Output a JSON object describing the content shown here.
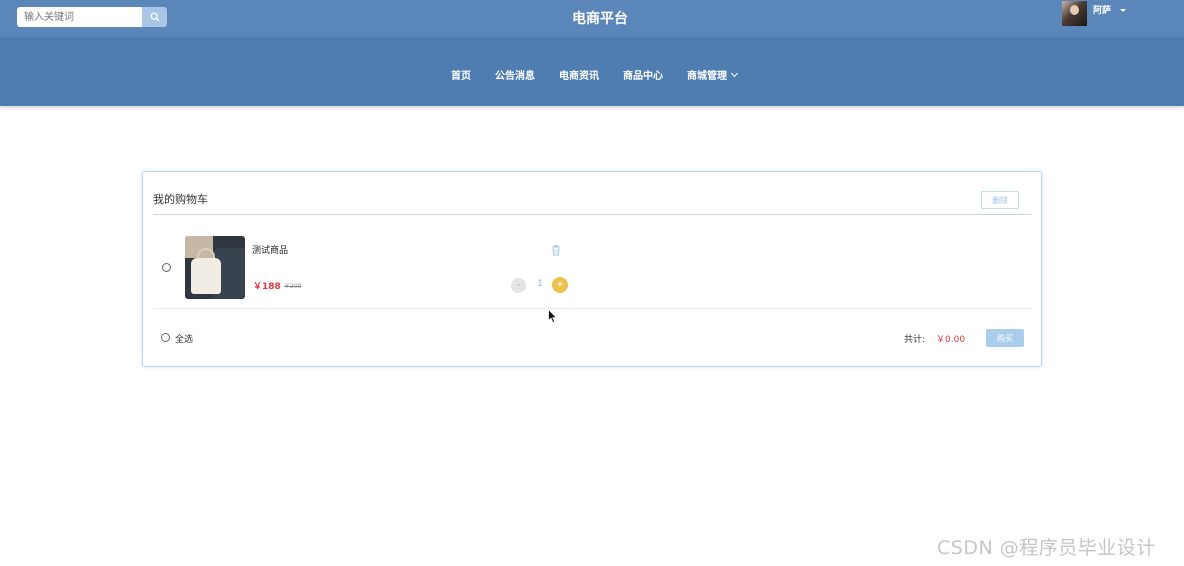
{
  "header": {
    "search_placeholder": "输入关键词",
    "site_title": "电商平台",
    "user": {
      "name": "阿萨"
    }
  },
  "nav": {
    "items": [
      {
        "label": "首页"
      },
      {
        "label": "公告消息"
      },
      {
        "label": "电商资讯"
      },
      {
        "label": "商品中心"
      },
      {
        "label": "商城管理"
      }
    ]
  },
  "cart": {
    "title": "我的购物车",
    "delete_label": "删除",
    "items": [
      {
        "name": "测试商品",
        "price": "￥188",
        "original_price": "￥200",
        "quantity": "1",
        "minus": "-",
        "plus": "+"
      }
    ],
    "select_all_label": "全选",
    "total_label": "共计:",
    "total_value": "￥0.00",
    "buy_label": "购买"
  },
  "watermark": "CSDN @程序员毕业设计",
  "colors": {
    "topbar": "#5b86ba",
    "navbar": "#4f7db1",
    "price": "#e0393e",
    "plus_button": "#e9c24c",
    "buy_button": "#a9cdea"
  }
}
